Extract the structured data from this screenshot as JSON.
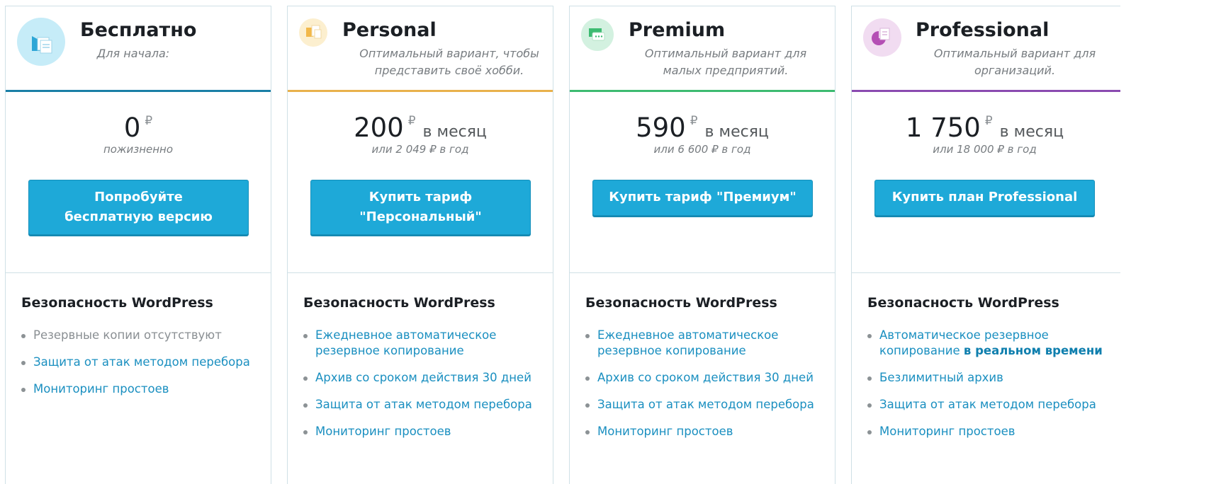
{
  "plans": [
    {
      "name": "Бесплатно",
      "subtitle": "Для начала:",
      "accent": "#1a7fa6",
      "icon": "backup-documents-icon",
      "amount": "0",
      "currency": "₽",
      "period": "",
      "note": "пожизненно",
      "button": "Попробуйте бесплатную версию",
      "features_title": "Безопасность WordPress",
      "features": [
        "Резервные копии отсутствуют",
        "Защита от атак методом перебора",
        "Мониторинг простоев"
      ]
    },
    {
      "name": "Personal",
      "subtitle": "Оптимальный вариант, чтобы представить своё хобби.",
      "accent": "#e9b14c",
      "icon": "personal-files-icon",
      "amount": "200",
      "currency": "₽",
      "period": "в месяц",
      "note": "или 2 049 ₽ в год",
      "button": "Купить тариф \"Персональный\"",
      "features_title": "Безопасность WordPress",
      "features": [
        "Ежедневное автоматическое резервное копирование",
        "Архив со сроком действия 30 дней",
        "Защита от атак методом перебора",
        "Мониторинг простоев"
      ]
    },
    {
      "name": "Premium",
      "subtitle": "Оптимальный вариант для малых предприятий.",
      "accent": "#3dbb71",
      "icon": "premium-chat-icon",
      "amount": "590",
      "currency": "₽",
      "period": "в месяц",
      "note": "или 6 600 ₽ в год",
      "button": "Купить тариф \"Премиум\"",
      "features_title": "Безопасность WordPress",
      "features": [
        "Ежедневное автоматическое резервное копирование",
        "Архив со сроком действия 30 дней",
        "Защита от атак методом перебора",
        "Мониторинг простоев"
      ]
    },
    {
      "name": "Professional",
      "subtitle": "Оптимальный вариант для организаций.",
      "accent": "#8a4bb0",
      "icon": "professional-chart-icon",
      "amount": "1 750",
      "currency": "₽",
      "period": "в месяц",
      "note": "или 18 000 ₽ в год",
      "button": "Купить план Professional",
      "features_title": "Безопасность WordPress",
      "features": [
        "Автоматическое резервное копирование",
        "Безлимитный архив",
        "Защита от атак методом перебора",
        "Мониторинг простоев"
      ],
      "feature_emphasis": "в реальном времени"
    }
  ]
}
